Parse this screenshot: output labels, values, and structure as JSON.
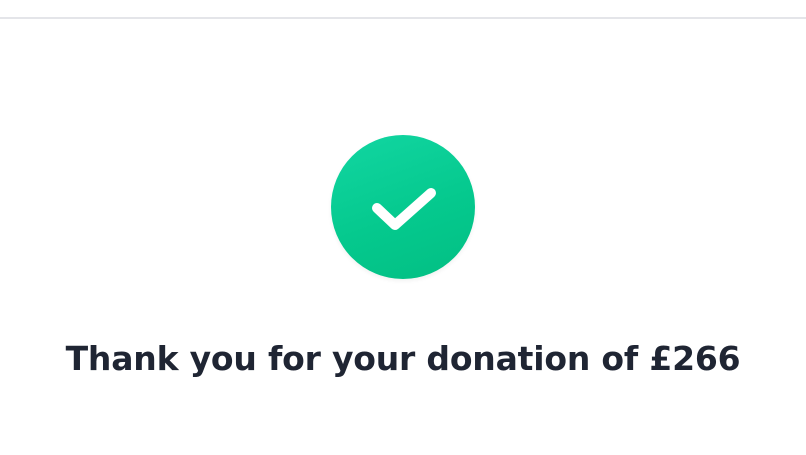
{
  "colors": {
    "success_green": "#06cc92",
    "heading_text": "#1f2533",
    "header_border": "#e4e5e9",
    "logo_purple": "#7b4fe0"
  },
  "icons": {
    "success": "checkmark-icon"
  },
  "confirmation": {
    "message": "Thank you for your donation of £266"
  }
}
